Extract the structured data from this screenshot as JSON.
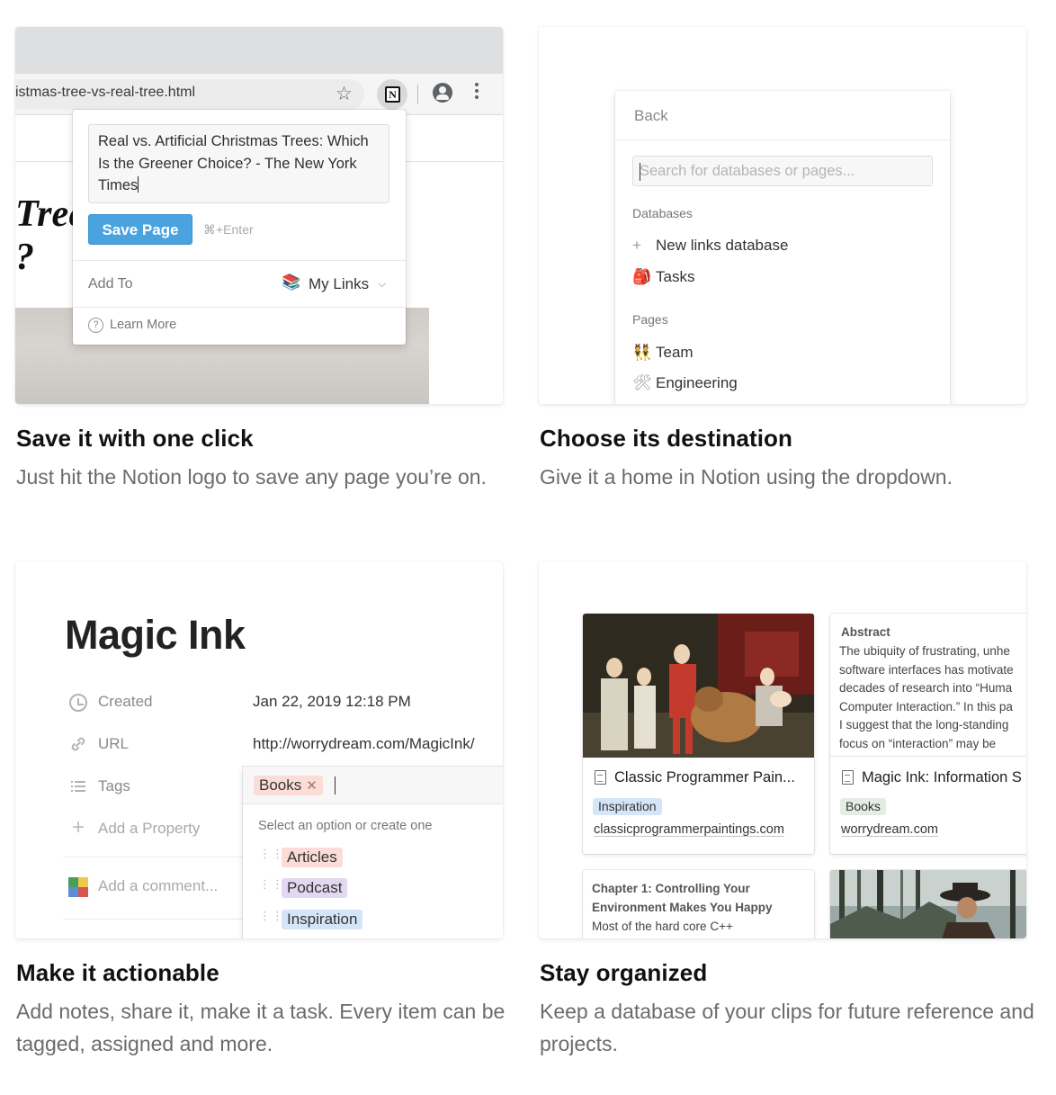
{
  "captions": [
    {
      "title": "Save it with one click",
      "desc": "Just hit the Notion logo to save any page you’re on."
    },
    {
      "title": "Choose its destination",
      "desc": "Give it a home in Notion using the dropdown."
    },
    {
      "title": "Make it actionable",
      "desc": "Add notes, share it, make it a task. Every item can be tagged, assigned and more."
    },
    {
      "title": "Stay organized",
      "desc": "Keep a database of your clips for future reference and projects."
    }
  ],
  "browser": {
    "url": "istmas-tree-vs-real-tree.html",
    "page_title_fragment_1": "Tree",
    "page_title_fragment_2": "?",
    "notion_logo_letter": "N"
  },
  "clipper": {
    "title_value": "Real vs. Artificial Christmas Trees: Which Is the Greener Choice? - The New York Times",
    "save_label": "Save Page",
    "shortcut": "⌘+Enter",
    "add_to_label": "Add To",
    "destination": "My Links",
    "learn_more": "Learn More"
  },
  "destination_panel": {
    "back": "Back",
    "search_placeholder": "Search for databases or pages...",
    "databases_label": "Databases",
    "databases": [
      {
        "icon": "+",
        "label": "New links database"
      },
      {
        "icon": "🎒",
        "label": "Tasks"
      }
    ],
    "pages_label": "Pages",
    "pages": [
      {
        "icon": "👯",
        "label": "Team"
      },
      {
        "icon": "🛠",
        "label": "Engineering"
      }
    ]
  },
  "page_props": {
    "title": "Magic Ink",
    "created_label": "Created",
    "created_value": "Jan 22, 2019 12:18 PM",
    "url_label": "URL",
    "url_value": "http://worrydream.com/MagicInk/",
    "tags_label": "Tags",
    "add_property": "Add a Property",
    "add_comment": "Add a comment...",
    "selected_tag": "Books",
    "hint": "Select an option or create one",
    "options": [
      {
        "label": "Articles",
        "color": "#fbdcd6"
      },
      {
        "label": "Podcast",
        "color": "#e3d8f1"
      },
      {
        "label": "Inspiration",
        "color": "#d3e5f7"
      }
    ]
  },
  "gallery": {
    "cards": [
      {
        "title": "Classic Programmer Pain...",
        "tag": "Inspiration",
        "tag_color": "#d3e5f7",
        "link": "classicprogrammerpaintings.com"
      },
      {
        "title": "Magic Ink: Information S",
        "tag": "Books",
        "tag_color": "#e2ede4",
        "link": "worrydream.com"
      }
    ],
    "abstract_title": "Abstract",
    "abstract_lines": [
      "The ubiquity of frustrating, unhe",
      "software interfaces has motivate",
      "decades of research into “Huma",
      "Computer Interaction.” In this pa",
      "I suggest that the long-standing",
      "focus on “interaction” may be"
    ],
    "chapter_lines": [
      "Chapter 1: Controlling Your",
      "Environment Makes You Happy",
      "Most of the hard core C++"
    ]
  }
}
